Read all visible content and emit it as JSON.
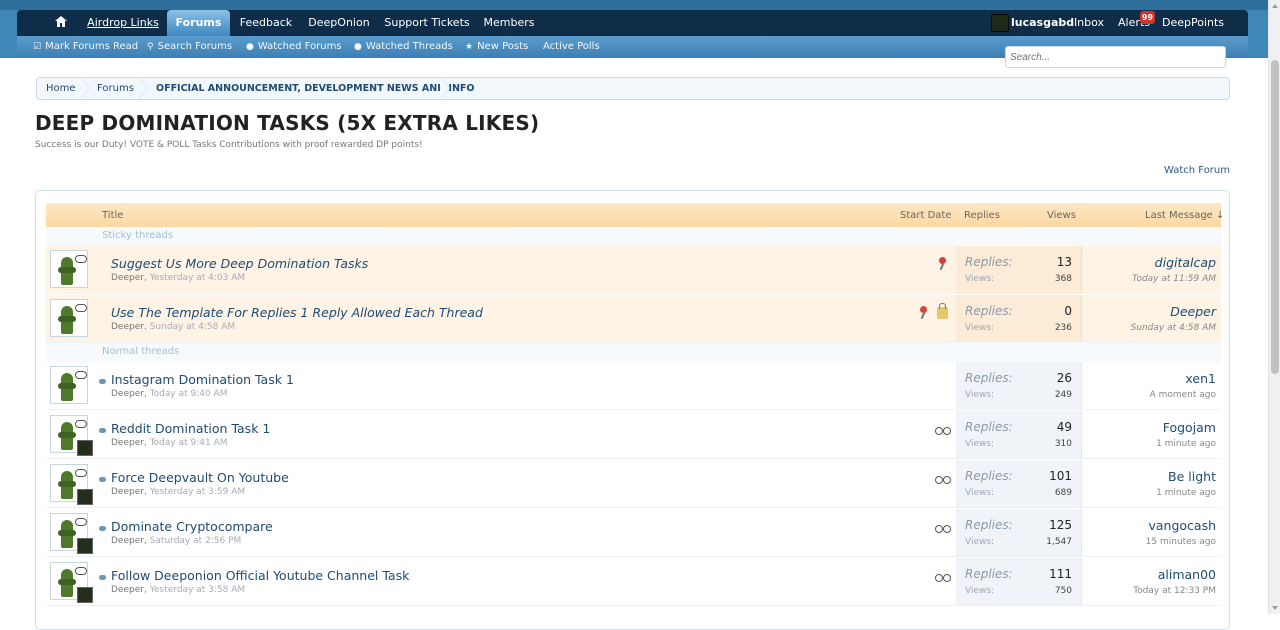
{
  "nav": {
    "home_icon": "home-icon",
    "tabs": [
      {
        "label": "Airdrop Links"
      },
      {
        "label": "Forums"
      },
      {
        "label": "Feedback"
      },
      {
        "label": "DeepOnion"
      },
      {
        "label": "Support Tickets"
      },
      {
        "label": "Members"
      }
    ],
    "user": "lucasgabd",
    "inbox": "Inbox",
    "alerts": "Alerts",
    "alerts_badge": "99",
    "points": "DeepPoints"
  },
  "subnav": [
    {
      "label": "Mark Forums Read",
      "icon": "check-square-icon"
    },
    {
      "label": "Search Forums",
      "icon": "search-icon"
    },
    {
      "label": "Watched Forums",
      "icon": "chat-bubble-icon"
    },
    {
      "label": "Watched Threads",
      "icon": "chat-bubbles-icon"
    },
    {
      "label": "New Posts",
      "icon": "star-icon"
    },
    {
      "label": "Active Polls",
      "icon": ""
    }
  ],
  "search": {
    "placeholder": "Search..."
  },
  "breadcrumb": [
    "Home",
    "Forums",
    "OFFICIAL ANNOUNCEMENT, DEVELOPMENT NEWS AND INFO"
  ],
  "title": "DEEP DOMINATION TASKS (5X EXTRA LIKES)",
  "description": "Success is our Duty! VOTE & POLL Tasks Contributions with proof rewarded DP points!",
  "watch_label": "Watch Forum",
  "columns": {
    "title": "Title",
    "start": "Start Date",
    "replies": "Replies",
    "views": "Views",
    "last": "Last Message ↓"
  },
  "sections": {
    "sticky": "Sticky threads",
    "normal": "Normal threads"
  },
  "labels": {
    "replies": "Replies:",
    "views": "Views:"
  },
  "sticky_threads": [
    {
      "title": "Suggest Us More Deep Domination Tasks",
      "author": "Deeper",
      "date": "Yesterday at 4:03 AM",
      "replies": "13",
      "views": "368",
      "last_user": "digitalcap",
      "last_time": "Today at 11:59 AM",
      "icons": [
        "pin-icon"
      ]
    },
    {
      "title": "Use The Template For Replies 1 Reply Allowed Each Thread",
      "author": "Deeper",
      "date": "Sunday at 4:58 AM",
      "replies": "0",
      "views": "236",
      "last_user": "Deeper",
      "last_time": "Sunday at 4:58 AM",
      "icons": [
        "pin-icon",
        "lock-icon"
      ]
    }
  ],
  "normal_threads": [
    {
      "title": "Instagram Domination Task 1",
      "author": "Deeper",
      "date": "Today at 9:40 AM",
      "replies": "26",
      "views": "249",
      "last_user": "xen1",
      "last_time": "A moment ago"
    },
    {
      "title": "Reddit Domination Task 1",
      "author": "Deeper",
      "date": "Today at 9:41 AM",
      "replies": "49",
      "views": "310",
      "last_user": "Fogojam",
      "last_time": "1 minute ago"
    },
    {
      "title": "Force Deepvault On Youtube",
      "author": "Deeper",
      "date": "Yesterday at 3:59 AM",
      "replies": "101",
      "views": "689",
      "last_user": "Be light",
      "last_time": "1 minute ago"
    },
    {
      "title": "Dominate Cryptocompare",
      "author": "Deeper",
      "date": "Saturday at 2:56 PM",
      "replies": "125",
      "views": "1,547",
      "last_user": "vangocash",
      "last_time": "15 minutes ago"
    },
    {
      "title": "Follow Deeponion Official Youtube Channel Task",
      "author": "Deeper",
      "date": "Yesterday at 3:58 AM",
      "replies": "111",
      "views": "750",
      "last_user": "aliman00",
      "last_time": "Today at 12:33 PM"
    }
  ]
}
